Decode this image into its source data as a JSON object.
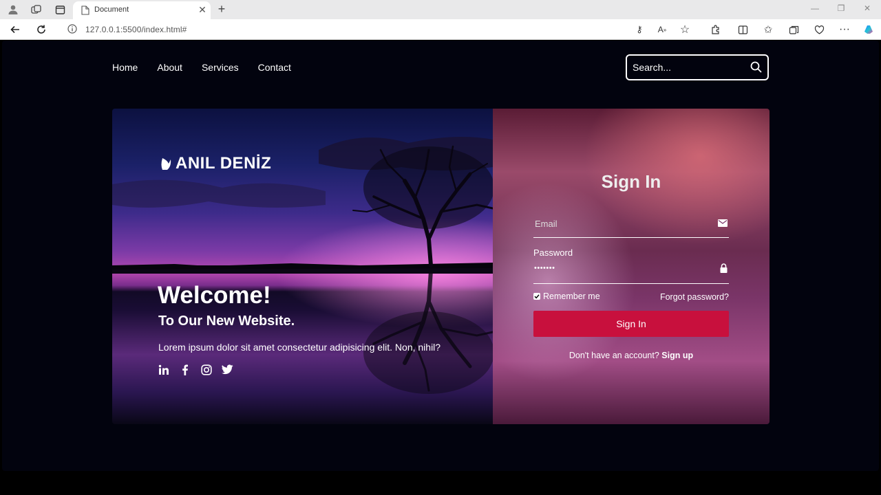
{
  "browser": {
    "tab_title": "Document",
    "url": "127.0.0.1:5500/index.html#"
  },
  "nav": {
    "items": [
      "Home",
      "About",
      "Services",
      "Contact"
    ],
    "search_placeholder": "Search..."
  },
  "hero": {
    "brand": "ANIL DENİZ",
    "welcome": "Welcome!",
    "subtitle": "To Our New Website.",
    "description": "Lorem ipsum dolor sit amet consectetur adipisicing elit. Non, nihil?",
    "socials": [
      "linkedin-icon",
      "facebook-icon",
      "instagram-icon",
      "twitter-icon"
    ]
  },
  "form": {
    "title": "Sign In",
    "email_label": "Email",
    "password_label": "Password",
    "password_value": "•••••••",
    "remember_label": "Remember me",
    "forgot_label": "Forgot password?",
    "submit_label": "Sign In",
    "signup_prompt": "Don't have an account?",
    "signup_link": "Sign up"
  },
  "colors": {
    "page_bg": "#02030e",
    "accent": "#c8103d"
  }
}
